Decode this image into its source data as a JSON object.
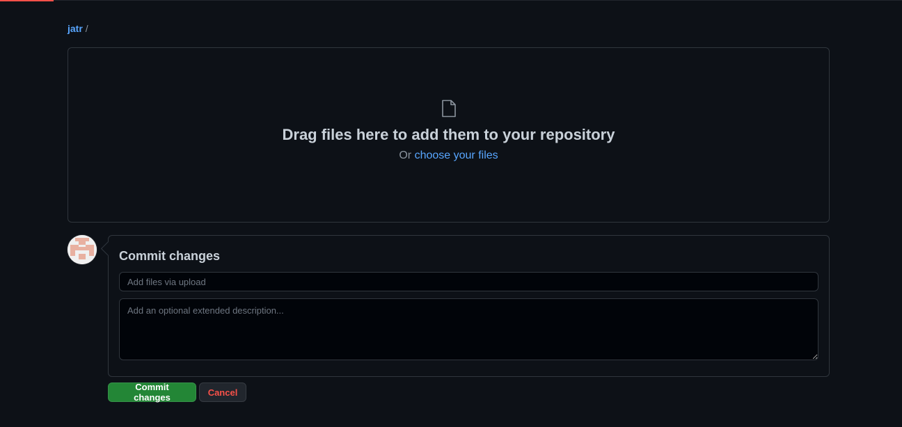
{
  "breadcrumb": {
    "repo_owner": "jatr",
    "separator": "/"
  },
  "dropzone": {
    "icon": "file-icon",
    "title": "Drag files here to add them to your repository",
    "or_text": "Or",
    "choose_link": "choose your files"
  },
  "commit": {
    "title": "Commit changes",
    "summary_placeholder": "Add files via upload",
    "summary_value": "",
    "description_placeholder": "Add an optional extended description...",
    "description_value": ""
  },
  "buttons": {
    "commit_label": "Commit changes",
    "cancel_label": "Cancel"
  },
  "colors": {
    "background": "#0d1117",
    "link": "#58a6ff",
    "primary_button": "#238636",
    "danger_text": "#f85149",
    "border": "#30363d"
  }
}
